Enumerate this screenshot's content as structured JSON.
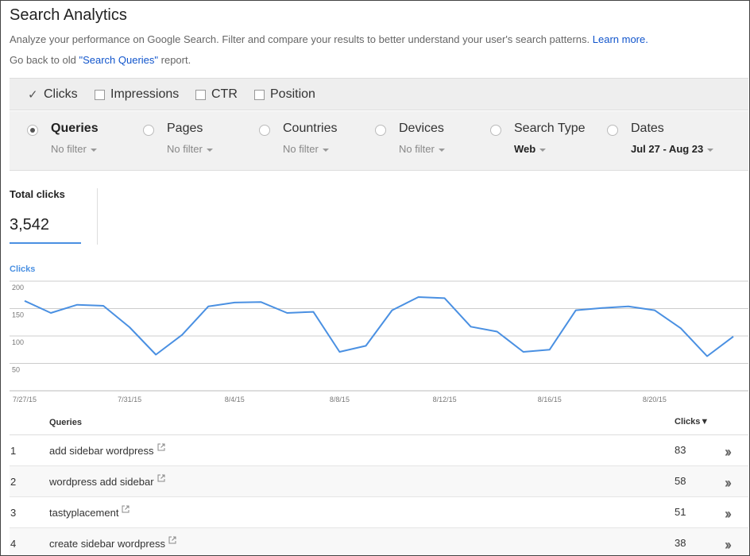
{
  "header": {
    "title": "Search Analytics",
    "description": "Analyze your performance on Google Search. Filter and compare your results to better understand your user's search patterns.",
    "learn_more": "Learn more.",
    "back_prefix": "Go back to old",
    "back_link": "\"Search Queries\"",
    "back_suffix": "report."
  },
  "metrics": [
    {
      "label": "Clicks",
      "checked": true
    },
    {
      "label": "Impressions",
      "checked": false
    },
    {
      "label": "CTR",
      "checked": false
    },
    {
      "label": "Position",
      "checked": false
    }
  ],
  "dimensions": [
    {
      "label": "Queries",
      "filter": "No filter",
      "selected": true
    },
    {
      "label": "Pages",
      "filter": "No filter",
      "selected": false
    },
    {
      "label": "Countries",
      "filter": "No filter",
      "selected": false
    },
    {
      "label": "Devices",
      "filter": "No filter",
      "selected": false
    },
    {
      "label": "Search Type",
      "filter": "Web",
      "selected": false
    },
    {
      "label": "Dates",
      "filter": "Jul 27 - Aug 23",
      "selected": false
    }
  ],
  "summary": {
    "label": "Total clicks",
    "value": "3,542"
  },
  "colors": {
    "accent": "#4a90e2",
    "link": "#1155cc"
  },
  "chart_data": {
    "type": "line",
    "ylabel": "Clicks",
    "ylim": [
      0,
      200
    ],
    "yticks": [
      50,
      100,
      150,
      200
    ],
    "xtick_labels": [
      "7/27/15",
      "7/31/15",
      "8/4/15",
      "8/8/15",
      "8/12/15",
      "8/16/15",
      "8/20/15"
    ],
    "x": [
      "7/27/15",
      "7/28/15",
      "7/29/15",
      "7/30/15",
      "7/31/15",
      "8/1/15",
      "8/2/15",
      "8/3/15",
      "8/4/15",
      "8/5/15",
      "8/6/15",
      "8/7/15",
      "8/8/15",
      "8/9/15",
      "8/10/15",
      "8/11/15",
      "8/12/15",
      "8/13/15",
      "8/14/15",
      "8/15/15",
      "8/16/15",
      "8/17/15",
      "8/18/15",
      "8/19/15",
      "8/20/15",
      "8/21/15",
      "8/22/15",
      "8/23/15"
    ],
    "series": [
      {
        "values": [
          164,
          142,
          157,
          155,
          116,
          66,
          102,
          154,
          161,
          162,
          142,
          144,
          71,
          82,
          147,
          171,
          169,
          117,
          108,
          71,
          75,
          147,
          151,
          154,
          147,
          114,
          63,
          99
        ]
      }
    ],
    "grid": true
  },
  "table": {
    "col_query": "Queries",
    "col_clicks": "Clicks▼",
    "rows": [
      {
        "index": "1",
        "query": "add sidebar wordpress",
        "clicks": "83"
      },
      {
        "index": "2",
        "query": "wordpress add sidebar",
        "clicks": "58"
      },
      {
        "index": "3",
        "query": "tastyplacement",
        "clicks": "51"
      },
      {
        "index": "4",
        "query": "create sidebar wordpress",
        "clicks": "38"
      }
    ]
  }
}
